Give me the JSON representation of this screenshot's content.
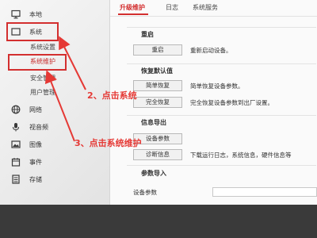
{
  "sidebar": {
    "items": [
      {
        "label": "本地",
        "icon": "monitor-icon"
      },
      {
        "label": "系统",
        "icon": "system-icon"
      },
      {
        "label": "网络",
        "icon": "network-icon"
      },
      {
        "label": "视音频",
        "icon": "microphone-icon"
      },
      {
        "label": "图像",
        "icon": "image-icon"
      },
      {
        "label": "事件",
        "icon": "calendar-icon"
      },
      {
        "label": "存储",
        "icon": "storage-icon"
      }
    ],
    "subitems": [
      "系统设置",
      "系统维护",
      "安全管理",
      "用户管理"
    ]
  },
  "tabs": [
    "升级维护",
    "日志",
    "系统服务"
  ],
  "sections": {
    "reboot": {
      "title": "重启",
      "button": "重启",
      "desc": "重新启动设备。"
    },
    "restore": {
      "title": "恢复默认值",
      "simple_button": "简单恢复",
      "simple_desc": "简单恢复设备参数。",
      "full_button": "完全恢复",
      "full_desc": "完全恢复设备参数到出厂设置。"
    },
    "export": {
      "title": "信息导出",
      "button1": "设备参数",
      "button2": "诊断信息",
      "desc": "下载运行日志，系统信息，硬件信息等"
    },
    "import": {
      "title": "参数导入",
      "label": "设备参数"
    }
  },
  "annotations": {
    "step2": "2、点击系统",
    "step3": "3、点击系统维护"
  },
  "colors": {
    "accent": "#d32f2f",
    "bottom_bar": "#3a3a3a"
  }
}
